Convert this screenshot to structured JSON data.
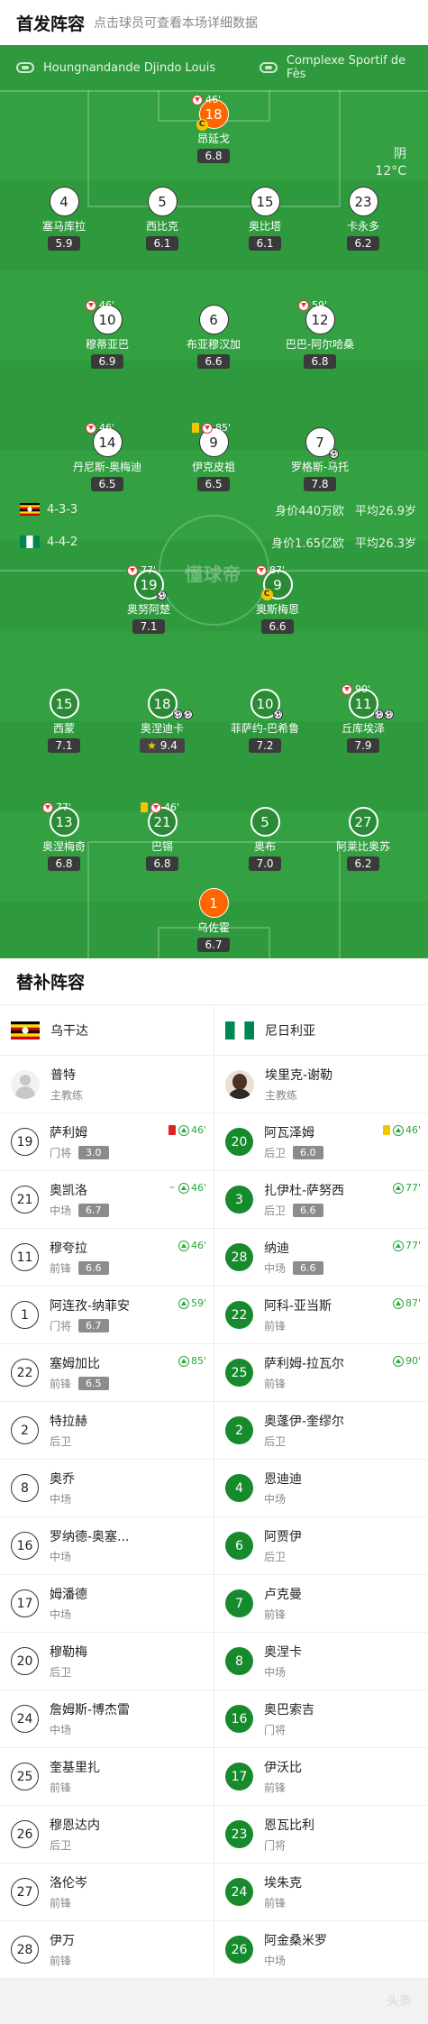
{
  "header": {
    "title": "首发阵容",
    "subtitle": "点击球员可查看本场详细数据"
  },
  "venue": {
    "referee": "Houngnandande Djindo Louis",
    "stadium": "Complexe Sportif de Fès"
  },
  "weather": {
    "condition": "阴",
    "temperature": "12°C"
  },
  "pitch_logo": "懂球帝",
  "teams": {
    "home": {
      "formation": "4-3-3",
      "value": "身价440万欧",
      "age": "平均26.9岁"
    },
    "away": {
      "formation": "4-4-2",
      "value": "身价1.65亿欧",
      "age": "平均26.3岁"
    }
  },
  "home_players": [
    {
      "num": "18",
      "name": "昂延戈",
      "rating": "6.8",
      "sub": "46'"
    },
    {
      "num": "4",
      "name": "塞马库拉",
      "rating": "5.9"
    },
    {
      "num": "5",
      "name": "西比克",
      "rating": "6.1"
    },
    {
      "num": "15",
      "name": "奥比塔",
      "rating": "6.1"
    },
    {
      "num": "23",
      "name": "卡永多",
      "rating": "6.2"
    },
    {
      "num": "10",
      "name": "穆蒂亚巴",
      "rating": "6.9",
      "sub": "46'"
    },
    {
      "num": "6",
      "name": "布亚穆汉加",
      "rating": "6.6"
    },
    {
      "num": "12",
      "name": "巴巴-阿尔哈桑",
      "rating": "6.8",
      "sub": "59'"
    },
    {
      "num": "14",
      "name": "丹尼斯-奥梅迪",
      "rating": "6.5",
      "sub": "46'"
    },
    {
      "num": "9",
      "name": "伊克皮祖",
      "rating": "6.5",
      "sub": "85'"
    },
    {
      "num": "7",
      "name": "罗格斯-马托",
      "rating": "7.8"
    }
  ],
  "away_players": [
    {
      "num": "19",
      "name": "奥努阿楚",
      "rating": "7.1",
      "sub": "77'"
    },
    {
      "num": "9",
      "name": "奥斯梅恩",
      "rating": "6.6",
      "sub": "87'"
    },
    {
      "num": "15",
      "name": "西蒙",
      "rating": "7.1"
    },
    {
      "num": "18",
      "name": "奥涅迪卡",
      "rating": "9.4"
    },
    {
      "num": "10",
      "name": "菲萨约-巴希鲁",
      "rating": "7.2"
    },
    {
      "num": "11",
      "name": "丘库埃泽",
      "rating": "7.9",
      "sub": "90'"
    },
    {
      "num": "13",
      "name": "奥涅梅奇",
      "rating": "6.8",
      "sub": "77'"
    },
    {
      "num": "21",
      "name": "巴锡",
      "rating": "6.8",
      "sub": "46'"
    },
    {
      "num": "5",
      "name": "奥布",
      "rating": "7.0"
    },
    {
      "num": "27",
      "name": "阿莱比奥苏",
      "rating": "6.2"
    },
    {
      "num": "1",
      "name": "乌佐霍",
      "rating": "6.7"
    }
  ],
  "bench": {
    "title": "替补阵容",
    "home": {
      "team": "乌干达",
      "coach": {
        "name": "普特",
        "role": "主教练"
      },
      "players": [
        {
          "num": "19",
          "name": "萨利姆",
          "pos": "门将",
          "rating": "3.0",
          "sub": "46'"
        },
        {
          "num": "21",
          "name": "奥凯洛",
          "pos": "中场",
          "rating": "6.7",
          "sub": "46'"
        },
        {
          "num": "11",
          "name": "穆夸拉",
          "pos": "前锋",
          "rating": "6.6",
          "sub": "46'"
        },
        {
          "num": "1",
          "name": "阿连孜-纳菲安",
          "pos": "门将",
          "rating": "6.7",
          "sub": "59'"
        },
        {
          "num": "22",
          "name": "塞姆加比",
          "pos": "前锋",
          "rating": "6.5",
          "sub": "85'"
        },
        {
          "num": "2",
          "name": "特拉赫",
          "pos": "后卫"
        },
        {
          "num": "8",
          "name": "奥乔",
          "pos": "中场"
        },
        {
          "num": "16",
          "name": "罗纳德-奥塞...",
          "pos": "中场"
        },
        {
          "num": "17",
          "name": "姆潘德",
          "pos": "中场"
        },
        {
          "num": "20",
          "name": "穆勒梅",
          "pos": "后卫"
        },
        {
          "num": "24",
          "name": "詹姆斯-博杰雷",
          "pos": "中场"
        },
        {
          "num": "25",
          "name": "奎基里扎",
          "pos": "前锋"
        },
        {
          "num": "26",
          "name": "穆恩达内",
          "pos": "后卫"
        },
        {
          "num": "27",
          "name": "洛伦岑",
          "pos": "前锋"
        },
        {
          "num": "28",
          "name": "伊万",
          "pos": "前锋"
        }
      ]
    },
    "away": {
      "team": "尼日利亚",
      "coach": {
        "name": "埃里克-谢勒",
        "role": "主教练"
      },
      "players": [
        {
          "num": "20",
          "name": "阿瓦泽姆",
          "pos": "后卫",
          "rating": "6.0",
          "sub": "46'"
        },
        {
          "num": "3",
          "name": "扎伊杜-萨努西",
          "pos": "后卫",
          "rating": "6.6",
          "sub": "77'"
        },
        {
          "num": "28",
          "name": "纳迪",
          "pos": "中场",
          "rating": "6.6",
          "sub": "77'"
        },
        {
          "num": "22",
          "name": "阿科-亚当斯",
          "pos": "前锋",
          "sub": "87'"
        },
        {
          "num": "25",
          "name": "萨利姆-拉瓦尔",
          "pos": "前锋",
          "sub": "90'"
        },
        {
          "num": "2",
          "name": "奥蓬伊-奎缪尔",
          "pos": "后卫"
        },
        {
          "num": "4",
          "name": "恩迪迪",
          "pos": "中场"
        },
        {
          "num": "6",
          "name": "阿贾伊",
          "pos": "后卫"
        },
        {
          "num": "7",
          "name": "卢克曼",
          "pos": "前锋"
        },
        {
          "num": "8",
          "name": "奥涅卡",
          "pos": "中场"
        },
        {
          "num": "16",
          "name": "奥巴索吉",
          "pos": "门将"
        },
        {
          "num": "17",
          "name": "伊沃比",
          "pos": "前锋"
        },
        {
          "num": "23",
          "name": "恩瓦比利",
          "pos": "门将"
        },
        {
          "num": "24",
          "name": "埃朱克",
          "pos": "前锋"
        },
        {
          "num": "26",
          "name": "阿金桑米罗",
          "pos": "中场"
        }
      ]
    }
  },
  "colors": {
    "pitch": "#2f9a3d",
    "accent_green": "#168a2c",
    "gk_orange": "#ff6600"
  },
  "footer": {
    "watermark": "头条"
  }
}
